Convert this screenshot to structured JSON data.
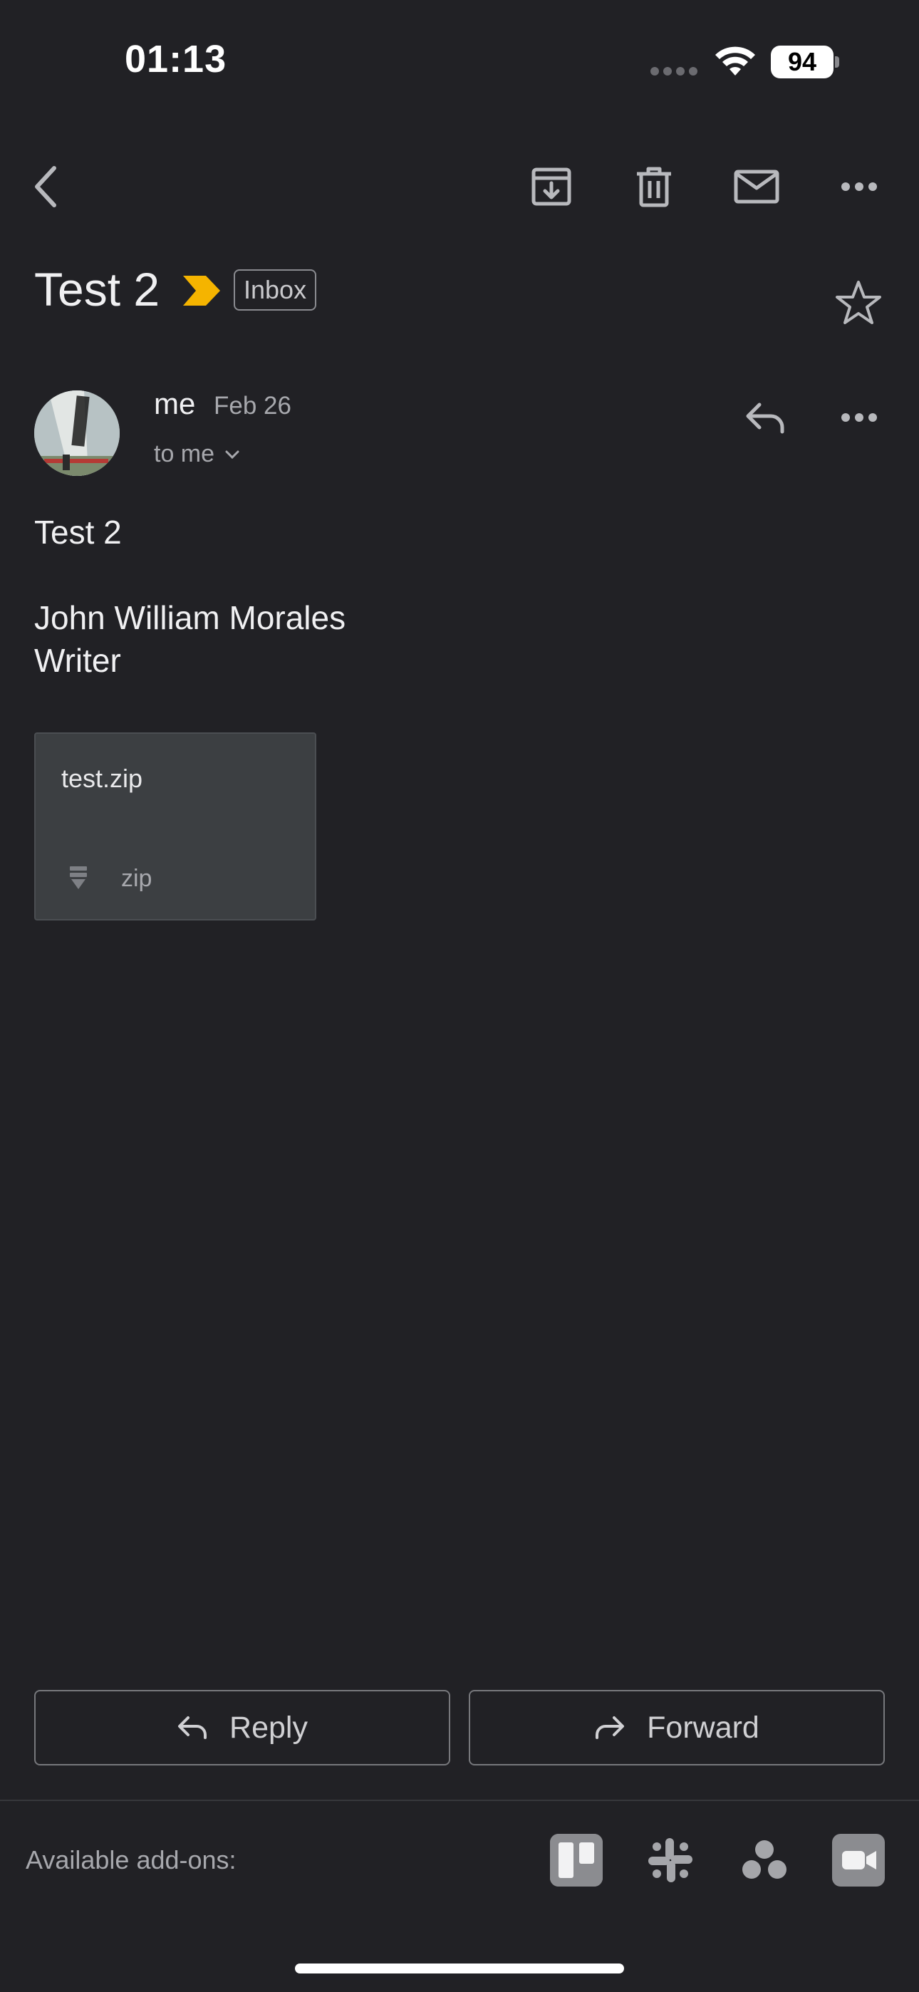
{
  "status_bar": {
    "time": "01:13",
    "battery": "94"
  },
  "toolbar": {
    "back_icon": "chevron-left-icon",
    "archive_icon": "archive-icon",
    "delete_icon": "trash-icon",
    "mark_unread_icon": "mail-icon",
    "more_icon": "more-horizontal-icon"
  },
  "email": {
    "subject": "Test 2",
    "label": "Inbox",
    "importance_color": "#F5B400",
    "sender": "me",
    "date": "Feb 26",
    "recipients": "to me",
    "body_line1": "Test 2",
    "signature_name": "John William Morales",
    "signature_title": "Writer",
    "attachment": {
      "name": "test.zip",
      "type": "zip"
    }
  },
  "actions": {
    "reply": "Reply",
    "forward": "Forward"
  },
  "addons": {
    "label": "Available add-ons:",
    "items": [
      "trello-icon",
      "slack-icon",
      "asana-icon",
      "zoom-icon"
    ]
  },
  "colors": {
    "background": "#212125",
    "attachment_card": "#3C3F42"
  }
}
